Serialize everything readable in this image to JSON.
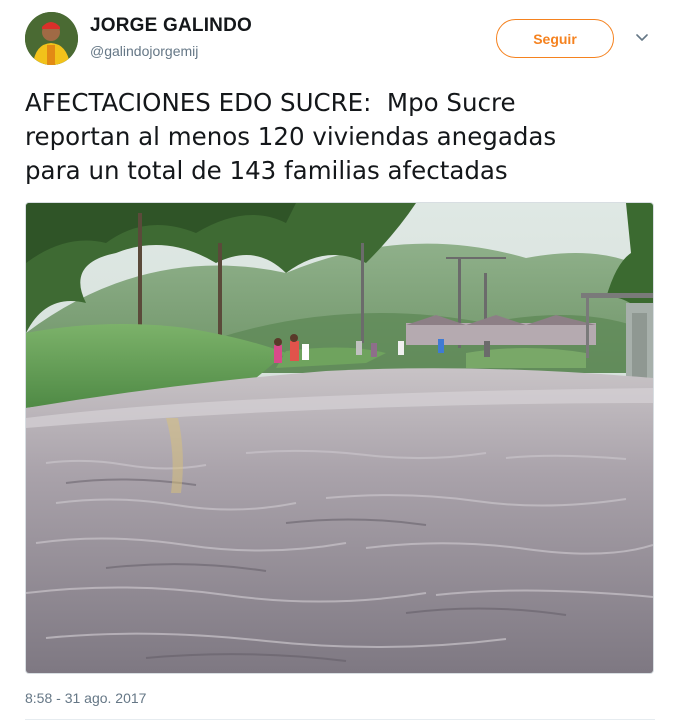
{
  "user": {
    "display_name": "JORGE GALINDO",
    "handle": "@galindojorgemij"
  },
  "actions": {
    "follow_label": "Seguir",
    "menu_icon": "chevron-down-icon"
  },
  "tweet": {
    "text": "AFECTACIONES EDO SUCRE:  Mpo Sucre\nreportan al menos 120 viviendas anegadas\npara un total de 143 familias afectadas",
    "timestamp": "8:58 - 31 ago. 2017"
  },
  "colors": {
    "accent": "#f5821f",
    "secondary_text": "#657786",
    "primary_text": "#14171a"
  }
}
